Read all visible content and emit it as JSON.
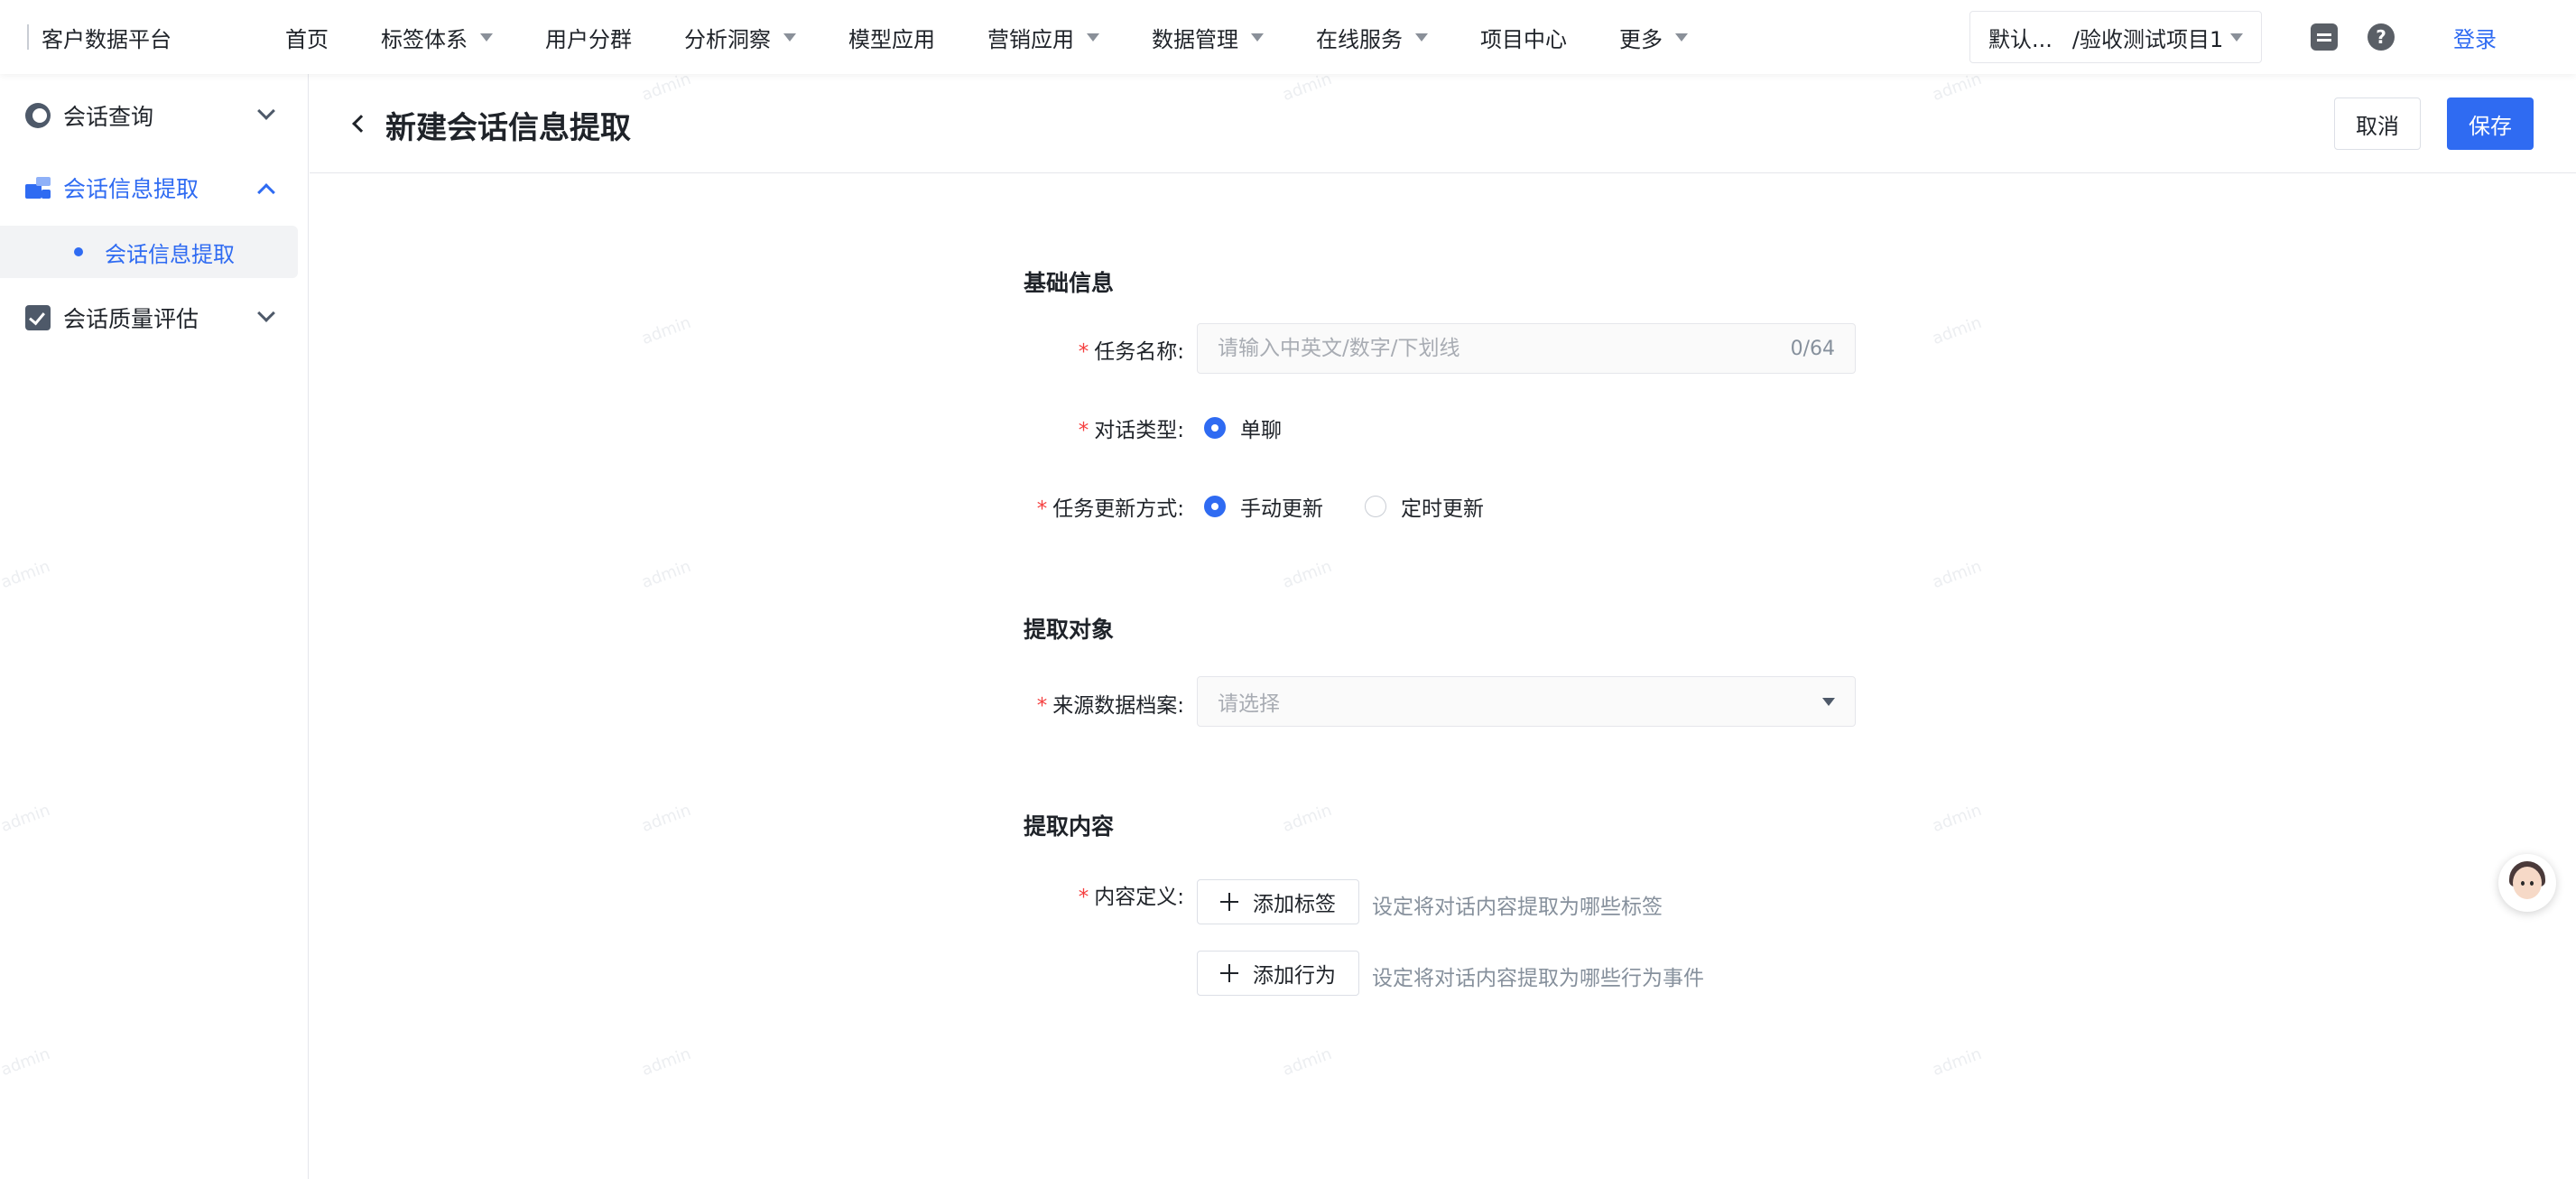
{
  "brand": "客户数据平台",
  "nav": [
    {
      "label": "首页",
      "dropdown": false
    },
    {
      "label": "标签体系",
      "dropdown": true
    },
    {
      "label": "用户分群",
      "dropdown": false
    },
    {
      "label": "分析洞察",
      "dropdown": true
    },
    {
      "label": "模型应用",
      "dropdown": false
    },
    {
      "label": "营销应用",
      "dropdown": true
    },
    {
      "label": "数据管理",
      "dropdown": true
    },
    {
      "label": "在线服务",
      "dropdown": true
    },
    {
      "label": "项目中心",
      "dropdown": false
    },
    {
      "label": "更多",
      "dropdown": true
    }
  ],
  "project": {
    "part1": "默认...",
    "part2": "/验收测试项目1"
  },
  "login": "登录",
  "help_glyph": "?",
  "sidebar": {
    "items": [
      {
        "label": "会话查询",
        "icon": "headset-icon"
      },
      {
        "label": "会话信息提取",
        "icon": "extract-icon"
      },
      {
        "label": "会话质量评估",
        "icon": "quality-check-icon"
      }
    ],
    "sub_item": "会话信息提取"
  },
  "page": {
    "title": "新建会话信息提取",
    "cancel": "取消",
    "save": "保存"
  },
  "form": {
    "sections": {
      "basic": "基础信息",
      "target": "提取对象",
      "content": "提取内容"
    },
    "required_mark": "*",
    "task_name": {
      "label": "任务名称:",
      "placeholder": "请输入中英文/数字/下划线",
      "value": "",
      "counter": "0/64"
    },
    "chat_type": {
      "label": "对话类型:",
      "options": [
        {
          "label": "单聊",
          "checked": true
        }
      ]
    },
    "update_mode": {
      "label": "任务更新方式:",
      "options": [
        {
          "label": "手动更新",
          "checked": true
        },
        {
          "label": "定时更新",
          "checked": false
        }
      ]
    },
    "source": {
      "label": "来源数据档案:",
      "placeholder": "请选择"
    },
    "content_def": {
      "label": "内容定义:",
      "add_tag": "添加标签",
      "add_tag_hint": "设定将对话内容提取为哪些标签",
      "add_action": "添加行为",
      "add_action_hint": "设定将对话内容提取为哪些行为事件"
    }
  },
  "watermark": "admin",
  "colors": {
    "primary": "#2f6bf2",
    "required": "#f53f3f",
    "text": "#1f2329",
    "muted": "#86909c"
  }
}
